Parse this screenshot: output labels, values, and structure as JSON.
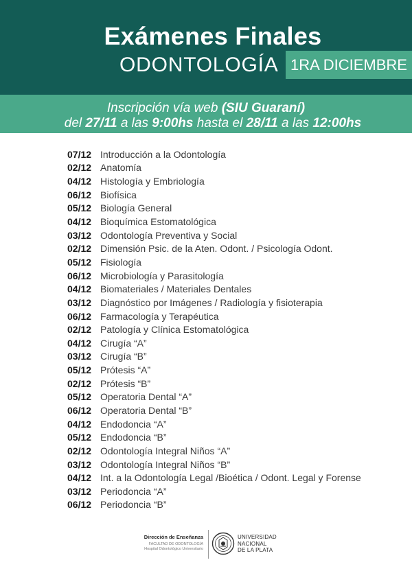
{
  "header": {
    "title": "Exámenes Finales",
    "subtitle": "ODONTOLOGÍA",
    "period": "1RA DICIEMBRE"
  },
  "registration": {
    "line1_a": "Inscripción vía web ",
    "line1_b": "(SIU Guaraní)",
    "l2_p1": "del ",
    "l2_p2": "27/11",
    "l2_p3": " a las ",
    "l2_p4": "9:00hs",
    "l2_p5": " hasta el ",
    "l2_p6": "28/11",
    "l2_p7": " a las ",
    "l2_p8": "12:00hs"
  },
  "exams": [
    {
      "date": "07/12",
      "subject": "Introducción a la Odontología"
    },
    {
      "date": "02/12",
      "subject": "Anatomía"
    },
    {
      "date": "04/12",
      "subject": "Histología y Embriología"
    },
    {
      "date": "06/12",
      "subject": "Biofísica"
    },
    {
      "date": "05/12",
      "subject": "Biología General"
    },
    {
      "date": "04/12",
      "subject": "Bioquímica Estomatológica"
    },
    {
      "date": "03/12",
      "subject": "Odontología Preventiva y Social"
    },
    {
      "date": "02/12",
      "subject": "Dimensión Psic. de la Aten. Odont. / Psicología Odont."
    },
    {
      "date": "05/12",
      "subject": "Fisiología"
    },
    {
      "date": "06/12",
      "subject": "Microbiología y Parasitología"
    },
    {
      "date": "04/12",
      "subject": "Biomateriales / Materiales Dentales"
    },
    {
      "date": "03/12",
      "subject": "Diagnóstico por Imágenes / Radiología y fisioterapia"
    },
    {
      "date": "06/12",
      "subject": "Farmacología y Terapéutica"
    },
    {
      "date": "02/12",
      "subject": "Patología y Clínica Estomatológica"
    },
    {
      "date": "04/12",
      "subject": "Cirugía “A”"
    },
    {
      "date": "03/12",
      "subject": "Cirugía “B”"
    },
    {
      "date": "05/12",
      "subject": "Prótesis “A”"
    },
    {
      "date": "02/12",
      "subject": "Prótesis “B”"
    },
    {
      "date": "05/12",
      "subject": "Operatoria Dental “A”"
    },
    {
      "date": "06/12",
      "subject": "Operatoria Dental “B”"
    },
    {
      "date": "04/12",
      "subject": "Endodoncia “A”"
    },
    {
      "date": "05/12",
      "subject": "Endodoncia “B”"
    },
    {
      "date": "02/12",
      "subject": "Odontología Integral Niños “A”"
    },
    {
      "date": "03/12",
      "subject": "Odontología Integral Niños “B”"
    },
    {
      "date": "04/12",
      "subject": "Int. a la Odontología Legal /Bioética / Odont. Legal y Forense"
    },
    {
      "date": "03/12",
      "subject": "Periodoncia “A”"
    },
    {
      "date": "06/12",
      "subject": "Periodoncia “B”"
    }
  ],
  "footer": {
    "direction": "Dirección de Enseñanza",
    "faculty": "FACULTAD DE ODONTOLOGÍA",
    "hospital": "Hospital Odontológico Universitario",
    "univ_1": "UNIVERSIDAD",
    "univ_2": "NACIONAL",
    "univ_3": "DE LA PLATA",
    "logo_icon": "university-seal-icon"
  },
  "colors": {
    "header_dark": "#135c55",
    "accent_green": "#4aa98a"
  }
}
